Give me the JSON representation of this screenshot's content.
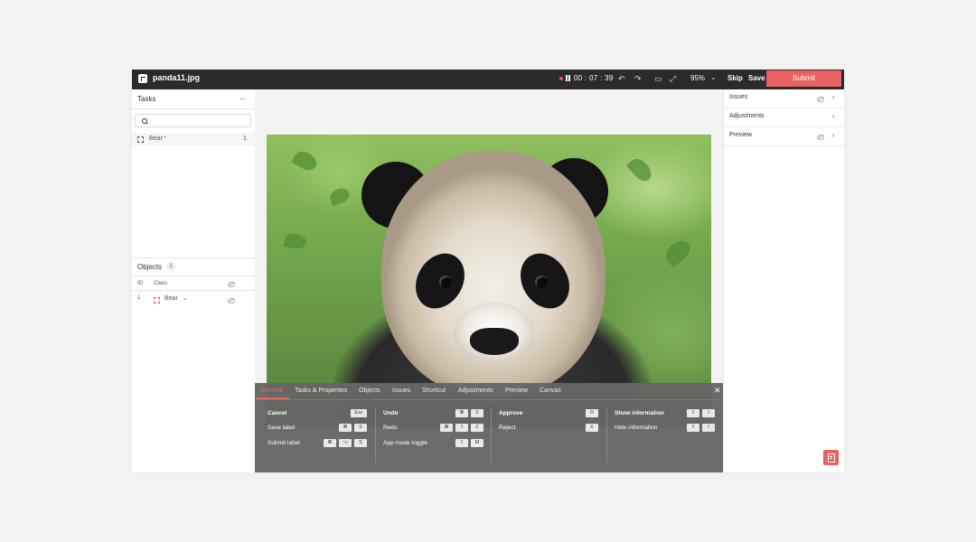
{
  "topbar": {
    "filename": "panda11.jpg",
    "timer": "00 : 07 : 39",
    "zoom": "95%",
    "skip_label": "Skip",
    "save_label": "Save",
    "submit_label": "Submit",
    "icons": [
      "undo-icon",
      "redo-icon",
      "keyboard-icon",
      "fullscreen-icon",
      "chevron-down-icon"
    ]
  },
  "tasks_panel": {
    "title": "Tasks",
    "more_icon": "ellipsis-icon",
    "search": {
      "placeholder": "",
      "value": ""
    },
    "tasks": [
      {
        "label": "Bear",
        "required_mark": "*",
        "count": "1"
      }
    ]
  },
  "objects_panel": {
    "title": "Objects",
    "count": "1",
    "columns": {
      "id": "ID",
      "class": "Class"
    },
    "rows": [
      {
        "id": "1",
        "class": "Bear"
      }
    ]
  },
  "shortcuts": {
    "tabs": [
      "General",
      "Tasks & Properties",
      "Objects",
      "Issues",
      "Shortcut",
      "Adjustments",
      "Preview",
      "Canvas"
    ],
    "active_tab": "General",
    "columns": [
      [
        {
          "label": "Cancel",
          "keys": [
            "Esc"
          ]
        },
        {
          "label": "Save label",
          "keys": [
            "⌘",
            "S"
          ]
        },
        {
          "label": "Submit label",
          "keys": [
            "⌘",
            "⌥",
            "S"
          ]
        }
      ],
      [
        {
          "label": "Undo",
          "keys": [
            "⌘",
            "Z"
          ]
        },
        {
          "label": "Redo",
          "keys": [
            "⌘",
            "⇧",
            "Z"
          ]
        },
        {
          "label": "App mode toggle",
          "keys": [
            "⇧",
            "M"
          ]
        }
      ],
      [
        {
          "label": "Approve",
          "keys": [
            "O"
          ]
        },
        {
          "label": "Reject",
          "keys": [
            "X"
          ]
        }
      ],
      [
        {
          "label": "Show information",
          "keys": [
            "⇧",
            "I"
          ]
        },
        {
          "label": "Hide information",
          "keys": [
            "⇧",
            "I"
          ]
        }
      ]
    ]
  },
  "right_panel": {
    "items": [
      {
        "label": "Issues"
      },
      {
        "label": "Adjustments"
      },
      {
        "label": "Preview"
      }
    ]
  },
  "colors": {
    "accent": "#e8635f",
    "topbar": "#2b2b2b",
    "overlay": "#666666"
  }
}
